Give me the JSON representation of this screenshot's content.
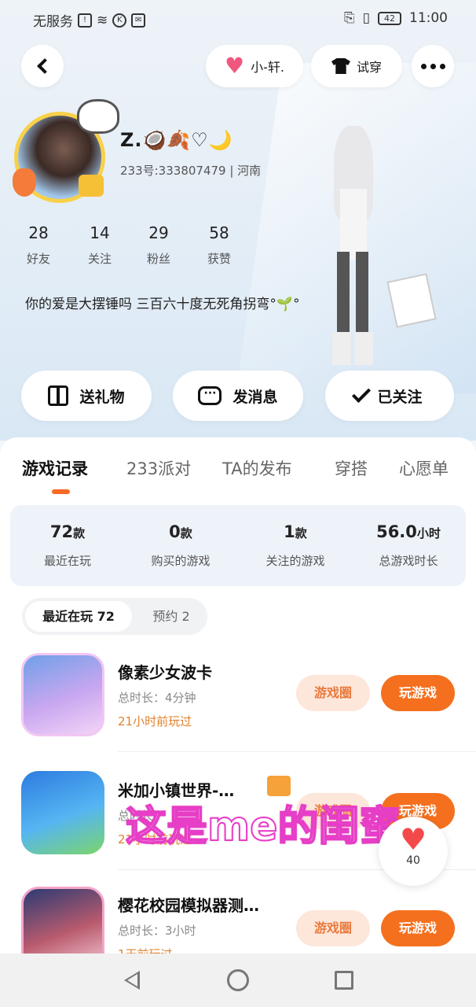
{
  "status_bar": {
    "carrier": "无服务",
    "battery": "42",
    "time": "11:00"
  },
  "header": {
    "friend_label": "小-轩.",
    "tryon_label": "试穿"
  },
  "profile": {
    "name": "Z.🥥🍂♡🌙",
    "uid_line": "233号:333807479 | 河南",
    "stats": [
      {
        "value": "28",
        "label": "好友"
      },
      {
        "value": "14",
        "label": "关注"
      },
      {
        "value": "29",
        "label": "粉丝"
      },
      {
        "value": "58",
        "label": "获赞"
      }
    ],
    "bio": "你的爱是大摆锤吗 三百六十度无死角拐弯°🌱°"
  },
  "actions": {
    "gift": "送礼物",
    "message": "发消息",
    "followed": "已关注"
  },
  "tabs": [
    "游戏记录",
    "233派对",
    "TA的发布",
    "穿搭",
    "心愿单"
  ],
  "summary": [
    {
      "value": "72",
      "unit": "款",
      "label": "最近在玩"
    },
    {
      "value": "0",
      "unit": "款",
      "label": "购买的游戏"
    },
    {
      "value": "1",
      "unit": "款",
      "label": "关注的游戏"
    },
    {
      "value": "56.0",
      "unit": "小时",
      "label": "总游戏时长"
    }
  ],
  "filters": {
    "active": "最近在玩 72",
    "other": "预约 2"
  },
  "games": [
    {
      "title": "像素少女波卡",
      "duration": "总时长：4分钟",
      "last_played": "21小时前玩过",
      "circle": "游戏圈",
      "play": "玩游戏"
    },
    {
      "title": "米加小镇世界-…",
      "duration": "总时长：",
      "last_played": "21小时前玩过",
      "circle": "游戏圈",
      "play": "玩游戏"
    },
    {
      "title": "樱花校园模拟器测…",
      "duration": "总时长：3小时",
      "last_played": "1天前玩过",
      "circle": "游戏圈",
      "play": "玩游戏"
    }
  ],
  "overlay": {
    "caption": "这是me的闺蜜",
    "like_count": "40"
  },
  "colors": {
    "accent": "#f5701e",
    "tab_indicator": "#f76a23",
    "caption_stroke": "#e63ec6"
  }
}
